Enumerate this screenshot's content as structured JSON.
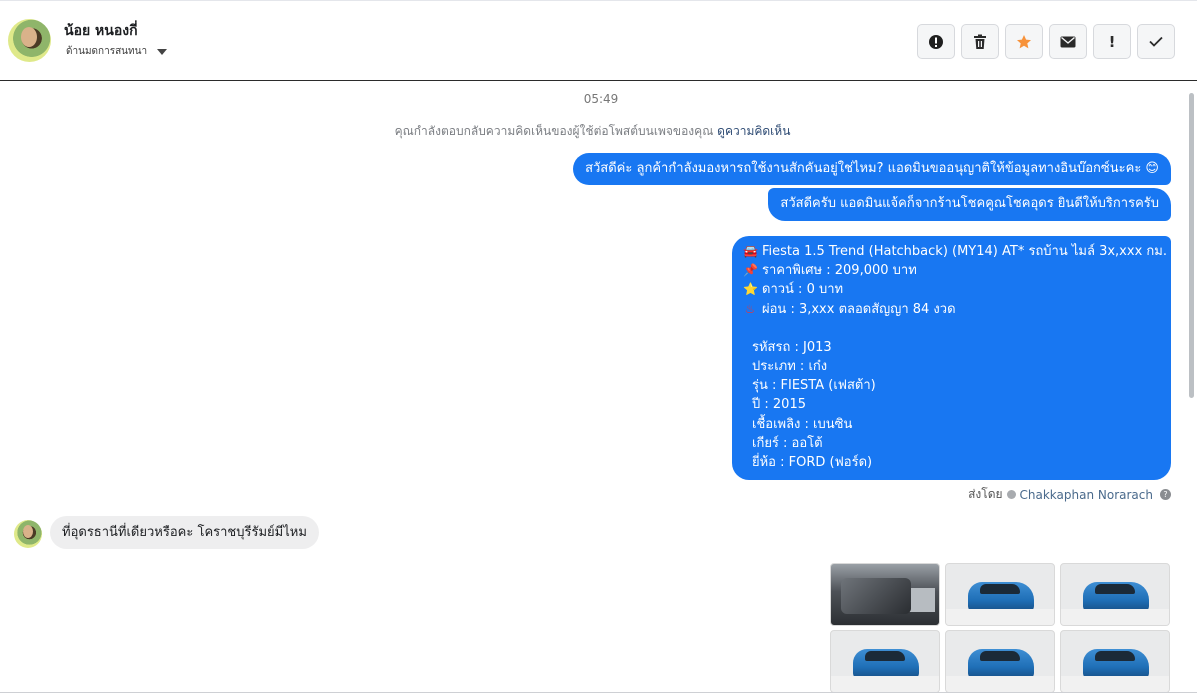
{
  "header": {
    "contact_name": "น้อย หนองกี่",
    "conversation_stage": "ด้านมดการสนทนา",
    "actions": [
      {
        "icon": "alert-circle-icon",
        "glyph": "!"
      },
      {
        "icon": "trash-icon",
        "glyph": ""
      },
      {
        "icon": "star-icon",
        "glyph": "★",
        "color": "#f7923a"
      },
      {
        "icon": "envelope-icon",
        "glyph": ""
      },
      {
        "icon": "exclamation-icon",
        "glyph": "!"
      },
      {
        "icon": "checkmark-icon",
        "glyph": "✓"
      }
    ]
  },
  "conversation": {
    "timestamp": "05:49",
    "context_note": "คุณกำลังตอบกลับความคิดเห็นของผู้ใช้ต่อโพสต์บนเพจของคุณ",
    "context_link": "ดูความคิดเห็น",
    "outgoing": [
      "สวัสดีค่ะ ลูกค้ากำลังมองหารถใช้งานสักคันอยู่ใช่ไหม? แอดมินขออนุญาติให้ข้อมูลทางอินบ๊อกซ์นะคะ 😊",
      "สวัสดีครับ แอดมินแจ้คก็จากร้านโชคคูณโชคอุดร ยินดีให้บริการครับ"
    ],
    "listing": {
      "headline": "Fiesta 1.5 Trend (Hatchback) (MY14) AT* รถบ้าน ไมล์ 3x,xxx กม.",
      "price": "ราคาพิเศษ : 209,000 บาท",
      "down": "ดาวน์ : 0 บาท",
      "installment": "ผ่อน : 3,xxx ตลอดสัญญา 84 งวด",
      "details": [
        "รหัสรถ : J013",
        "ประเภท : เก๋ง",
        "รุ่น : FIESTA (เฟสต้า)",
        "ปี : 2015",
        "เชื้อเพลิง : เบนซิน",
        "เกียร์ : ออโต้",
        "ยี่ห้อ : FORD (ฟอร์ด)"
      ]
    },
    "sent_by_label": "ส่งโดย",
    "sent_by_agent": "Chakkaphan Norarach",
    "incoming": "ที่อุดรธานีที่เดียวหรือคะ โคราชบุรีรัมย์มีไหม",
    "photos": [
      {
        "subject": "engine-bay"
      },
      {
        "subject": "front-three-quarter"
      },
      {
        "subject": "front"
      },
      {
        "subject": "front-side"
      },
      {
        "subject": "rear-three-quarter"
      },
      {
        "subject": "rear"
      }
    ]
  },
  "colors": {
    "outgoing_bubble": "#1877f2",
    "incoming_bubble": "#eeeeef",
    "star_accent": "#f7923a"
  }
}
